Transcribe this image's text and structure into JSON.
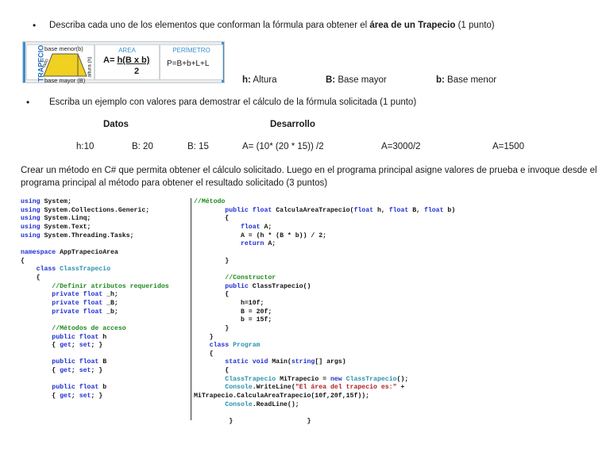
{
  "q1": {
    "pre": "Describa cada uno de los elementos que conforman la fórmula para obtener el ",
    "bold": "área de un Trapecio",
    "post": " (1 punto)"
  },
  "figure": {
    "side": "TRAPECIO",
    "top": "base menor(b)",
    "bottom": "base mayor (B)",
    "height": "altura (h)",
    "lado": "lado",
    "area_title": "AREA",
    "area_formula_pre": "A= ",
    "area_formula_num": "h(B x b)",
    "area_formula_den": "2",
    "perim_title": "PERÍMETRO",
    "perim_formula": "P=B+b+L+L"
  },
  "legend": [
    {
      "key": "h:",
      "text": " Altura"
    },
    {
      "key": "B:",
      "text": " Base mayor"
    },
    {
      "key": "b:",
      "text": " Base menor"
    }
  ],
  "q2": "Escriba un ejemplo con valores para demostrar el cálculo de la fórmula solicitada (1 punto)",
  "table": {
    "datos": "Datos",
    "desarrollo": "Desarrollo",
    "values": [
      "h:10",
      "B: 20",
      "B: 15",
      "A= (10* (20 * 15)) /2",
      "A=3000/2",
      "A=1500"
    ]
  },
  "q3": "Crear un método en C# que permita obtener el cálculo solicitado. Luego en el programa principal asigne valores de prueba e invoque desde el programa principal al método para obtener el resultado solicitado (3 puntos)",
  "code_left": [
    [
      [
        "using",
        "kw"
      ],
      [
        " System;",
        ""
      ]
    ],
    [
      [
        "using",
        "kw"
      ],
      [
        " System.Collections.Generic;",
        ""
      ]
    ],
    [
      [
        "using",
        "kw"
      ],
      [
        " System.Linq;",
        ""
      ]
    ],
    [
      [
        "using",
        "kw"
      ],
      [
        " System.Text;",
        ""
      ]
    ],
    [
      [
        "using",
        "kw"
      ],
      [
        " System.Threading.Tasks;",
        ""
      ]
    ],
    [],
    [
      [
        "namespace",
        "kw"
      ],
      [
        " AppTrapecioArea",
        ""
      ]
    ],
    [
      [
        "{",
        ""
      ]
    ],
    [
      [
        "    class ",
        "kw"
      ],
      [
        "ClassTrapecio",
        "ty"
      ]
    ],
    [
      [
        "    {",
        ""
      ]
    ],
    [
      [
        "        //Definir atributos requeridos",
        "cm"
      ]
    ],
    [
      [
        "        private float",
        "kw"
      ],
      [
        " _h;",
        ""
      ]
    ],
    [
      [
        "        private float",
        "kw"
      ],
      [
        " _B;",
        ""
      ]
    ],
    [
      [
        "        private float",
        "kw"
      ],
      [
        " _b;",
        ""
      ]
    ],
    [],
    [
      [
        "        //Métodos de acceso",
        "cm"
      ]
    ],
    [
      [
        "        public float",
        "kw"
      ],
      [
        " h",
        ""
      ]
    ],
    [
      [
        "        { ",
        ""
      ],
      [
        "get",
        "kw"
      ],
      [
        "; ",
        ""
      ],
      [
        "set",
        "kw"
      ],
      [
        "; }",
        ""
      ]
    ],
    [],
    [
      [
        "        public float",
        "kw"
      ],
      [
        " B",
        ""
      ]
    ],
    [
      [
        "        { ",
        ""
      ],
      [
        "get",
        "kw"
      ],
      [
        "; ",
        ""
      ],
      [
        "set",
        "kw"
      ],
      [
        "; }",
        ""
      ]
    ],
    [],
    [
      [
        "        public float",
        "kw"
      ],
      [
        " b",
        ""
      ]
    ],
    [
      [
        "        { ",
        ""
      ],
      [
        "get",
        "kw"
      ],
      [
        "; ",
        ""
      ],
      [
        "set",
        "kw"
      ],
      [
        "; }",
        ""
      ]
    ]
  ],
  "code_right": [
    [
      [
        "//Método",
        "cm"
      ]
    ],
    [
      [
        "        public float",
        "kw"
      ],
      [
        " CalculaAreaTrapecio(",
        ""
      ],
      [
        "float",
        "kw"
      ],
      [
        " h, ",
        ""
      ],
      [
        "float",
        "kw"
      ],
      [
        " B, ",
        ""
      ],
      [
        "float",
        "kw"
      ],
      [
        " b)",
        ""
      ]
    ],
    [
      [
        "        {",
        ""
      ]
    ],
    [
      [
        "            float",
        "kw"
      ],
      [
        " A;",
        ""
      ]
    ],
    [
      [
        "            A = (h * (B * b)) / 2;",
        ""
      ]
    ],
    [
      [
        "            return",
        "kw"
      ],
      [
        " A;",
        ""
      ]
    ],
    [],
    [
      [
        "        }",
        ""
      ]
    ],
    [],
    [
      [
        "        //Constructor",
        "cm"
      ]
    ],
    [
      [
        "        public",
        "kw"
      ],
      [
        " ClassTrapecio()",
        ""
      ]
    ],
    [
      [
        "        {",
        ""
      ]
    ],
    [
      [
        "            h=10f;",
        ""
      ]
    ],
    [
      [
        "            B = 20f;",
        ""
      ]
    ],
    [
      [
        "            b = 15f;",
        ""
      ]
    ],
    [
      [
        "        }",
        ""
      ]
    ],
    [
      [
        "    }",
        ""
      ]
    ],
    [
      [
        "    class ",
        "kw"
      ],
      [
        "Program",
        "ty"
      ]
    ],
    [
      [
        "    {",
        ""
      ]
    ],
    [
      [
        "        static void",
        "kw"
      ],
      [
        " Main(",
        ""
      ],
      [
        "string",
        "kw"
      ],
      [
        "[] args)",
        ""
      ]
    ],
    [
      [
        "        {",
        ""
      ]
    ],
    [
      [
        "        ClassTrapecio",
        "ty"
      ],
      [
        " MiTrapecio = ",
        ""
      ],
      [
        "new",
        "kw"
      ],
      [
        " ",
        ""
      ],
      [
        "ClassTrapecio",
        "ty"
      ],
      [
        "();",
        ""
      ]
    ],
    [
      [
        "        Console",
        "ty"
      ],
      [
        ".WriteLine(",
        ""
      ],
      [
        "\"El área del trapecio es:\"",
        "st"
      ],
      [
        " +",
        ""
      ]
    ],
    [
      [
        "MiTrapecio.CalculaAreaTrapecio(10f,20f,15f));",
        ""
      ]
    ],
    [
      [
        "        Console",
        "ty"
      ],
      [
        ".ReadLine();",
        ""
      ]
    ],
    [],
    [
      [
        "         }                   }",
        ""
      ]
    ]
  ]
}
